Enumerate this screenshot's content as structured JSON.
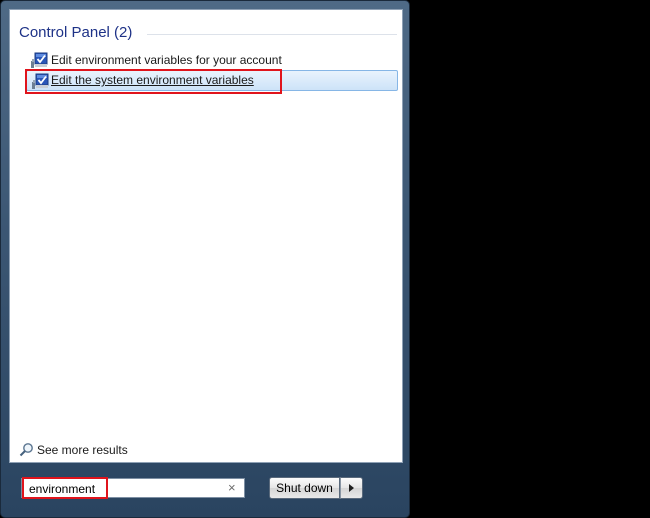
{
  "results": {
    "group_title": "Control Panel (2)",
    "items": [
      {
        "label": "Edit environment variables for your account",
        "icon": "control-panel-icon"
      },
      {
        "label": "Edit the system environment variables",
        "icon": "control-panel-icon",
        "selected": true
      }
    ],
    "see_more_label": "See more results"
  },
  "search": {
    "value": "environment",
    "clear_glyph": "×"
  },
  "power": {
    "shutdown_label": "Shut down"
  },
  "colors": {
    "annotation": "#e0141c",
    "header_text": "#1e3287",
    "selection": "#cde3f8"
  }
}
